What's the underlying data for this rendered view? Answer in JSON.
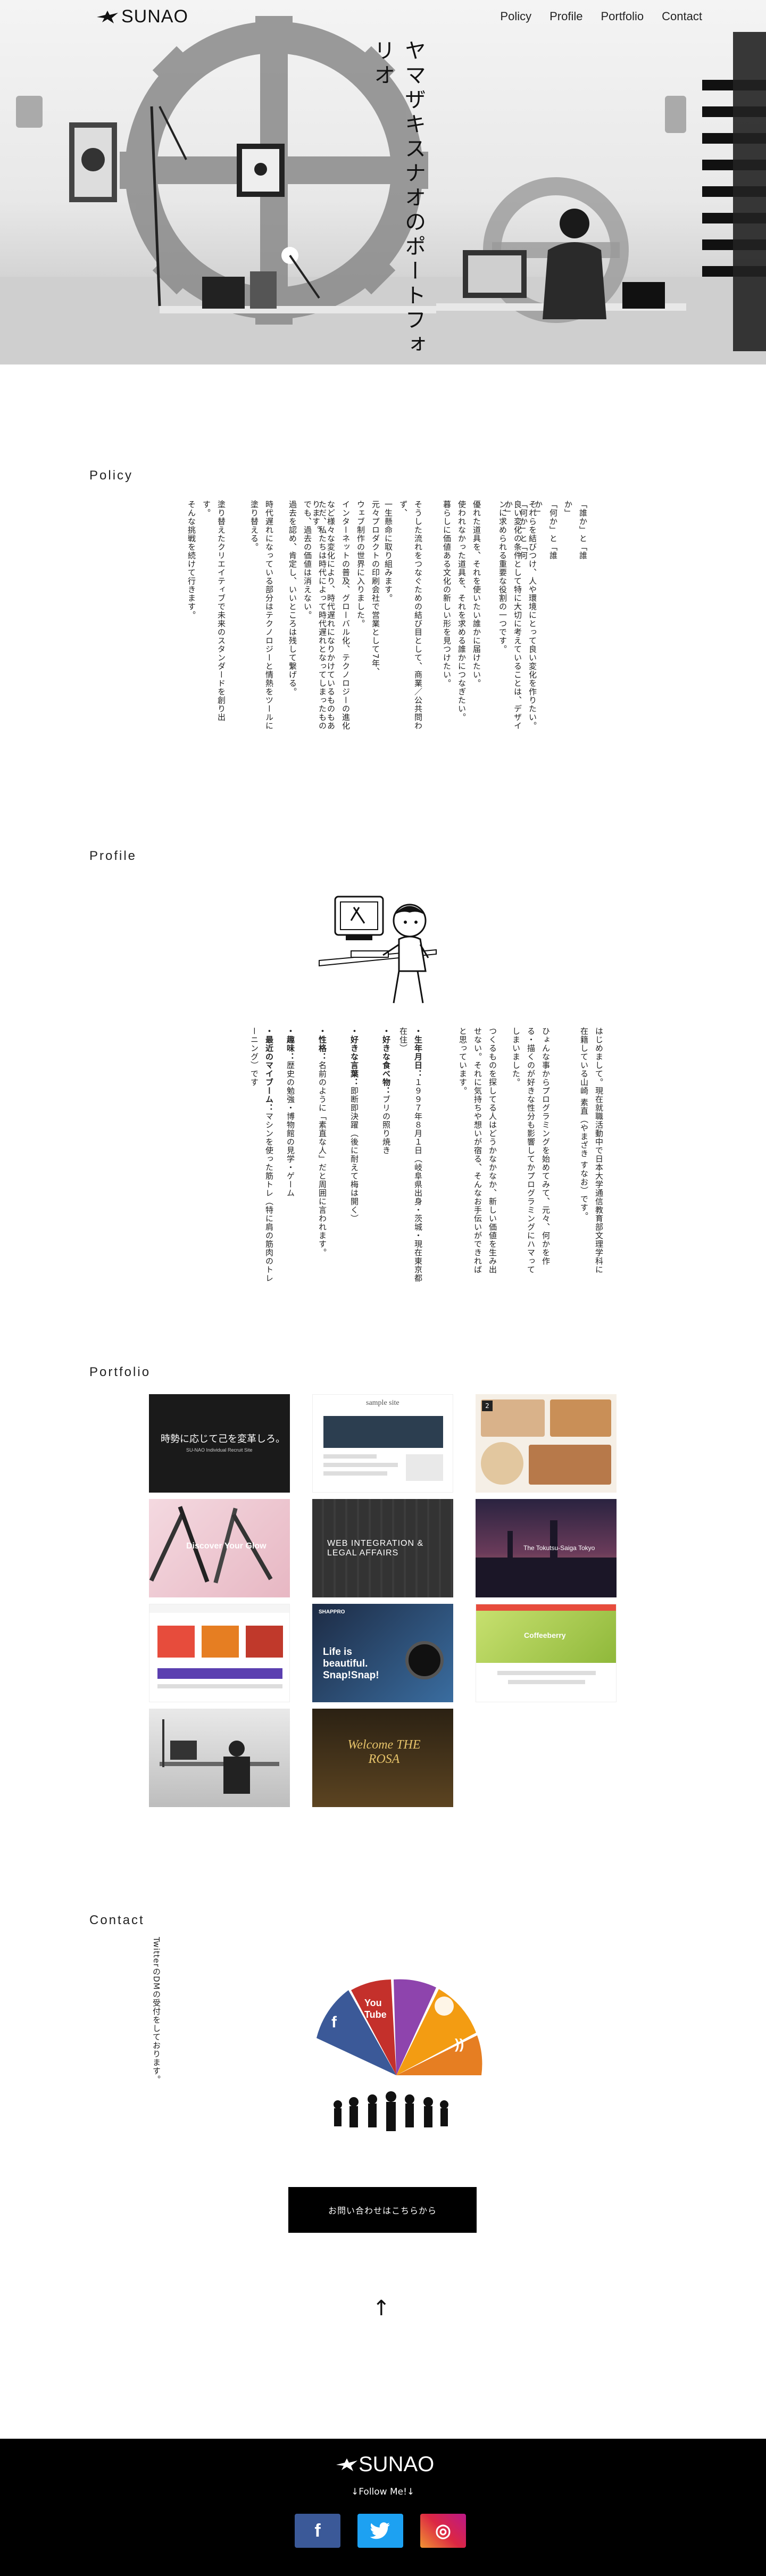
{
  "header": {
    "logo_text": "SUNAO",
    "nav": [
      "Policy",
      "Profile",
      "Portfolio",
      "Contact"
    ]
  },
  "hero": {
    "title": "ヤマザキスナオのポートフォリオ"
  },
  "policy": {
    "heading": "Policy",
    "paragraphs": [
      "「誰か」と「誰か」\n「何か」と「誰か」\n「何か」と「何か」",
      "それらを結びつけ、人や環境にとって良い変化を作りたい。\n良い変化の条件として特に大切に考えていることは、デザインに求められる重要な役割の一つです。",
      "優れた道具を、それを使いたい誰かに届けたい。\n使われなかった道具を、それを求める誰かにつなぎたい。\n暮らしに価値ある文化の新しい形を見つけたい。",
      "そうした流れをつなぐための結び目として、商業／公共問わず、\n一生懸命に取り組みます。",
      "元々プロダクトの印刷会社で営業として7年、\nウェブ制作の世界に入りました。\nインターネットの普及、グローバル化、テクノロジーの進化など様々な変化により、時代遅れになりかけているものもあります。",
      "ただ、私たちは時代によって時代遅れとなってしまったものでも、過去の価値は消えない。\n過去を認め、肯定し、いいところは残して繋げる。",
      "時代遅れになっている部分はテクノロジーと情熱をツールに塗り替える。",
      "塗り替えたクリエイティブで未来のスタンダードを創り出す。\nそんな挑戦を続けて行きます。"
    ]
  },
  "profile": {
    "heading": "Profile",
    "intro_1": "はじめまして。現在就職活動中で日本大学通信教育部文理学科に在籍している山崎 素直（やまざき すなお）です。",
    "intro_2": "ひょんな事からプログラミングを始めてみて、元々、何かを作る・描くのが好きな性分も影響してかプログラミングにハマってしまいました。",
    "intro_3": "つくるものを探してる人はどうかなかなか、新しい価値を生み出せない。それに気持ちや想いが宿る、そんなお手伝いができればと思っています。",
    "facts": [
      {
        "label": "・生年月日：",
        "value": "１９９７年８月１日（岐阜県出身・茨城・現在東京都在住）"
      },
      {
        "label": "・好きな食べ物：",
        "value": "ブリの照り焼き"
      },
      {
        "label": "・好きな言葉：",
        "value": "即断即決躍（後に耐えて梅は開く）"
      },
      {
        "label": "・性格：",
        "value": "名前のように「素直な人」だと周囲に言われます。"
      },
      {
        "label": "・趣味：",
        "value": "歴史の勉強・博物館の見学・ゲーム"
      },
      {
        "label": "・最近のマイブーム：",
        "value": "マシンを使った筋トレ（特に肩の筋肉のトレーニング）です"
      }
    ]
  },
  "portfolio": {
    "heading": "Portfolio",
    "items": [
      {
        "caption": "時勢に応じて己を変革しろ。",
        "sub": "SU-NAO Individual Recruit Site",
        "theme": "dark-red"
      },
      {
        "caption": "sample site",
        "sub": "",
        "theme": "white-sample"
      },
      {
        "caption": "",
        "sub": "",
        "theme": "food"
      },
      {
        "caption": "Discover Your Glow",
        "sub": "",
        "theme": "brushes"
      },
      {
        "caption": "WEB INTEGRATION & LEGAL AFFAIRS",
        "sub": "",
        "theme": "keyboard"
      },
      {
        "caption": "The Tokutsu-Saiga Tokyo",
        "sub": "",
        "theme": "city"
      },
      {
        "caption": "",
        "sub": "",
        "theme": "shop"
      },
      {
        "caption": "Life is beautiful. Snap!Snap!",
        "sub": "SHAPPRO",
        "theme": "camera"
      },
      {
        "caption": "Coffeeberry",
        "sub": "",
        "theme": "office"
      },
      {
        "caption": "",
        "sub": "",
        "theme": "studio"
      },
      {
        "caption": "Welcome THE ROSA",
        "sub": "",
        "theme": "rosa"
      }
    ]
  },
  "contact": {
    "heading": "Contact",
    "text": "TwitterのDMの受付をしております。",
    "button": "お問い合わせはこちらから",
    "back_to_top": "↑"
  },
  "footer": {
    "logo_text": "SUNAO",
    "follow": "↓Follow Me!↓",
    "social": [
      {
        "name": "facebook",
        "glyph": "f",
        "color": "#3b5998"
      },
      {
        "name": "twitter",
        "glyph": "t",
        "color": "#1da1f2"
      },
      {
        "name": "instagram",
        "glyph": "◎",
        "color": "#c13584"
      }
    ]
  }
}
